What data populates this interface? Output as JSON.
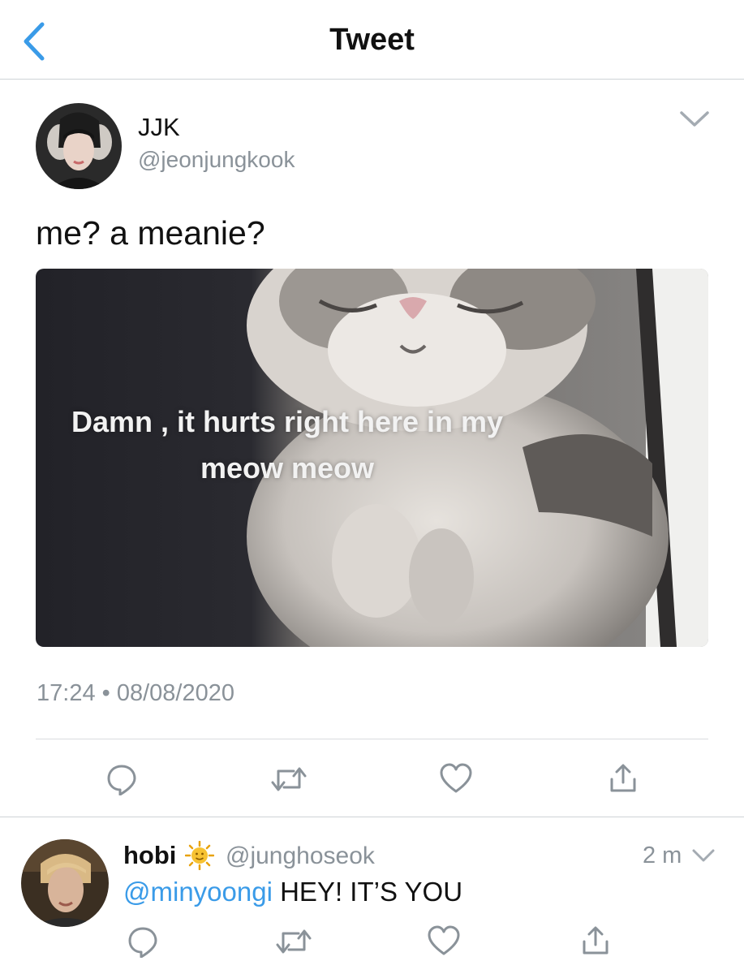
{
  "nav": {
    "title": "Tweet",
    "back_icon": "chevron-left-icon",
    "accent": "#3a9be8"
  },
  "tweet": {
    "author_name": "JJK",
    "author_handle": "@jeonjungkook",
    "text": "me? a meanie?",
    "media_caption": "Damn , it hurts right here in my meow meow",
    "timestamp": "17:24 • 08/08/2020",
    "actions": [
      "reply-icon",
      "retweet-icon",
      "like-icon",
      "share-icon"
    ]
  },
  "reply": {
    "author_name": "hobi",
    "emoji": "sun-face-icon",
    "author_handle": "@junghoseok",
    "time": "2 m",
    "mention": "@minyoongi",
    "text": " HEY! IT’S YOU",
    "actions": [
      "reply-icon",
      "retweet-icon",
      "like-icon",
      "share-icon"
    ]
  }
}
